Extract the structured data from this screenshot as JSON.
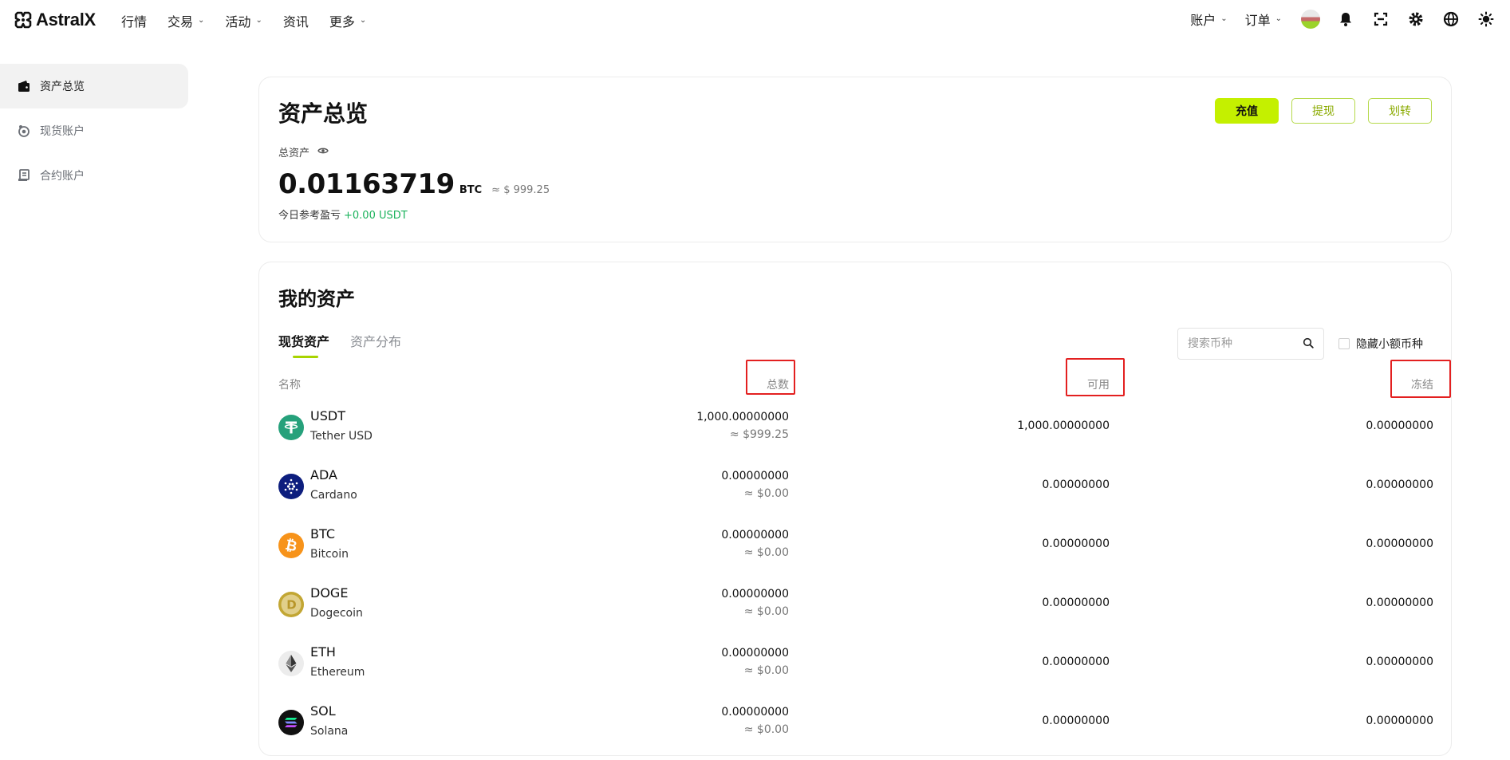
{
  "brand": {
    "name": "AstralX"
  },
  "nav": {
    "items": [
      {
        "label": "行情",
        "has_dropdown": false
      },
      {
        "label": "交易",
        "has_dropdown": true
      },
      {
        "label": "活动",
        "has_dropdown": true
      },
      {
        "label": "资讯",
        "has_dropdown": false
      },
      {
        "label": "更多",
        "has_dropdown": true
      }
    ],
    "account_label": "账户",
    "orders_label": "订单"
  },
  "sidebar": {
    "items": [
      {
        "label": "资产总览",
        "icon": "wallet-icon",
        "active": true
      },
      {
        "label": "现货账户",
        "icon": "spot-account-icon",
        "active": false
      },
      {
        "label": "合约账户",
        "icon": "futures-account-icon",
        "active": false
      }
    ]
  },
  "overview": {
    "title": "资产总览",
    "deposit_label": "充值",
    "withdraw_label": "提现",
    "transfer_label": "划转",
    "total_label": "总资产",
    "total_value": "0.01163719",
    "total_unit": "BTC",
    "total_usd": "≈ $ 999.25",
    "pnl_label": "今日参考盈亏",
    "pnl_value": "+0.00 USDT"
  },
  "assets": {
    "title": "我的资产",
    "tabs": [
      {
        "label": "现货资产",
        "active": true
      },
      {
        "label": "资产分布",
        "active": false
      }
    ],
    "search_placeholder": "搜索币种",
    "hide_small_label": "隐藏小额币种",
    "columns": {
      "name": "名称",
      "total": "总数",
      "available": "可用",
      "frozen": "冻结"
    },
    "rows": [
      {
        "symbol": "USDT",
        "name": "Tether USD",
        "total": "1,000.00000000",
        "total_usd": "≈ $999.25",
        "available": "1,000.00000000",
        "frozen": "0.00000000",
        "color": "#26a17b"
      },
      {
        "symbol": "ADA",
        "name": "Cardano",
        "total": "0.00000000",
        "total_usd": "≈ $0.00",
        "available": "0.00000000",
        "frozen": "0.00000000",
        "color": "#0d1e7e"
      },
      {
        "symbol": "BTC",
        "name": "Bitcoin",
        "total": "0.00000000",
        "total_usd": "≈ $0.00",
        "available": "0.00000000",
        "frozen": "0.00000000",
        "color": "#f7931a"
      },
      {
        "symbol": "DOGE",
        "name": "Dogecoin",
        "total": "0.00000000",
        "total_usd": "≈ $0.00",
        "available": "0.00000000",
        "frozen": "0.00000000",
        "color": "#c2a633"
      },
      {
        "symbol": "ETH",
        "name": "Ethereum",
        "total": "0.00000000",
        "total_usd": "≈ $0.00",
        "available": "0.00000000",
        "frozen": "0.00000000",
        "color": "#ececec"
      },
      {
        "symbol": "SOL",
        "name": "Solana",
        "total": "0.00000000",
        "total_usd": "≈ $0.00",
        "available": "0.00000000",
        "frozen": "0.00000000",
        "color": "#111111"
      }
    ]
  },
  "colors": {
    "accent": "#c4f000",
    "positive": "#1bb35c",
    "highlight_box": "#e32020"
  }
}
